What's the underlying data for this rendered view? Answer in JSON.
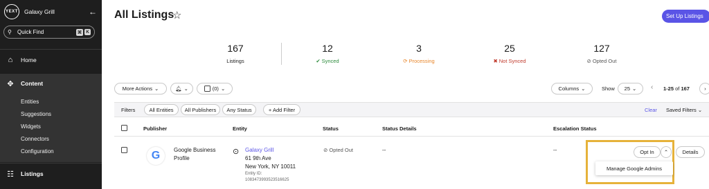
{
  "sidebar": {
    "brand_logo": "YEXT",
    "brand_name": "Galaxy Grill",
    "quick_find_label": "Quick Find",
    "quick_find_keys": [
      "⌘",
      "K"
    ],
    "nav": [
      {
        "label": "Home",
        "icon": "home-icon"
      },
      {
        "label": "Content",
        "icon": "content-icon"
      },
      {
        "label": "Listings",
        "icon": "listings-icon"
      }
    ],
    "content_items": [
      "Entities",
      "Suggestions",
      "Widgets",
      "Connectors",
      "Configuration"
    ]
  },
  "header": {
    "title": "All Listings",
    "setup_button": "Set Up Listings"
  },
  "stats": [
    {
      "value": "167",
      "label": "Listings",
      "color": "#1a1a1a",
      "icon": ""
    },
    {
      "value": "12",
      "label": "Synced",
      "color": "#2a8a3a",
      "icon": "✔"
    },
    {
      "value": "3",
      "label": "Processing",
      "color": "#e8862a",
      "icon": "⟳"
    },
    {
      "value": "25",
      "label": "Not Synced",
      "color": "#c0392b",
      "icon": "✖"
    },
    {
      "value": "127",
      "label": "Opted Out",
      "color": "#555555",
      "icon": "⊘"
    }
  ],
  "toolbar": {
    "more_actions": "More Actions",
    "selection_count": "(0)",
    "columns": "Columns",
    "show_label": "Show",
    "page_size": "25",
    "range": "1-25",
    "range_of": "of",
    "total": "167"
  },
  "filters": {
    "label": "Filters",
    "chips": [
      "All Entities",
      "All Publishers",
      "Any Status"
    ],
    "add_filter": "+ Add Filter",
    "clear": "Clear",
    "saved_filters": "Saved Filters"
  },
  "table": {
    "columns": [
      "Publisher",
      "Entity",
      "Status",
      "Status Details",
      "Escalation Status"
    ],
    "rows": [
      {
        "publisher": "Google Business Profile",
        "publisher_logo": "G",
        "entity_name": "Galaxy Grill",
        "address1": "61 9th Ave",
        "address2": "New York, NY 10011",
        "entity_id_label": "Entity ID:",
        "entity_id": "1083473993523516625",
        "status": "Opted Out",
        "status_details": "--",
        "escalation": "--",
        "opt_in": "Opt In",
        "details": "Details",
        "dropdown_item": "Manage Google Admins"
      }
    ]
  },
  "colors": {
    "accent": "#5a54e6",
    "highlight": "#e6b23a",
    "sidebar_bg": "#1e1e1e"
  }
}
